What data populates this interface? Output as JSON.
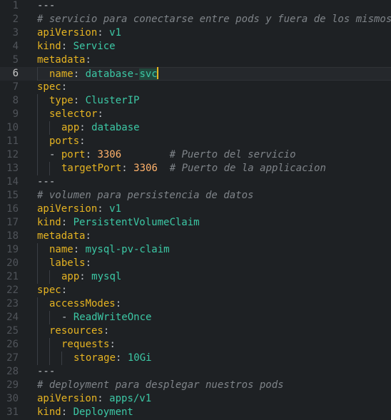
{
  "editor": {
    "language": "yaml",
    "current_line": 6,
    "colors": {
      "background": "#1e2124",
      "key": "#e6b422",
      "value": "#3cc8a5",
      "number": "#ffb26b",
      "comment": "#7f8489",
      "punctuation": "#c0c4c8",
      "line_number": "#50545a"
    },
    "lines": [
      {
        "num": "1",
        "indent": 0,
        "tokens": [
          {
            "t": "---",
            "c": "p"
          }
        ]
      },
      {
        "num": "2",
        "indent": 0,
        "tokens": [
          {
            "t": "# servicio para conectarse entre pods y fuera de los mismos",
            "c": "c"
          }
        ]
      },
      {
        "num": "3",
        "indent": 0,
        "tokens": [
          {
            "t": "apiVersion",
            "c": "k"
          },
          {
            "t": ": ",
            "c": "p"
          },
          {
            "t": "v1",
            "c": "v"
          }
        ]
      },
      {
        "num": "4",
        "indent": 0,
        "tokens": [
          {
            "t": "kind",
            "c": "k"
          },
          {
            "t": ": ",
            "c": "p"
          },
          {
            "t": "Service",
            "c": "v"
          }
        ]
      },
      {
        "num": "5",
        "indent": 0,
        "tokens": [
          {
            "t": "metadata",
            "c": "k"
          },
          {
            "t": ":",
            "c": "p"
          }
        ]
      },
      {
        "num": "6",
        "indent": 1,
        "tokens": [
          {
            "t": "name",
            "c": "k"
          },
          {
            "t": ": ",
            "c": "p"
          },
          {
            "t": "database-",
            "c": "v"
          },
          {
            "t": "svc",
            "c": "v sel"
          },
          {
            "caret": true
          }
        ]
      },
      {
        "num": "7",
        "indent": 0,
        "tokens": [
          {
            "t": "spec",
            "c": "k"
          },
          {
            "t": ":",
            "c": "p"
          }
        ]
      },
      {
        "num": "8",
        "indent": 1,
        "tokens": [
          {
            "t": "type",
            "c": "k"
          },
          {
            "t": ": ",
            "c": "p"
          },
          {
            "t": "ClusterIP",
            "c": "v"
          }
        ]
      },
      {
        "num": "9",
        "indent": 1,
        "tokens": [
          {
            "t": "selector",
            "c": "k"
          },
          {
            "t": ":",
            "c": "p"
          }
        ]
      },
      {
        "num": "10",
        "indent": 2,
        "tokens": [
          {
            "t": "app",
            "c": "k"
          },
          {
            "t": ": ",
            "c": "p"
          },
          {
            "t": "database",
            "c": "v"
          }
        ]
      },
      {
        "num": "11",
        "indent": 1,
        "tokens": [
          {
            "t": "ports",
            "c": "k"
          },
          {
            "t": ":",
            "c": "p"
          }
        ]
      },
      {
        "num": "12",
        "indent": 1,
        "tokens": [
          {
            "t": "- ",
            "c": "p"
          },
          {
            "t": "port",
            "c": "k"
          },
          {
            "t": ": ",
            "c": "p"
          },
          {
            "t": "3306",
            "c": "n"
          },
          {
            "t": "        ",
            "c": "p"
          },
          {
            "t": "# Puerto del servicio",
            "c": "c"
          }
        ]
      },
      {
        "num": "13",
        "indent": 2,
        "tokens": [
          {
            "t": "targetPort",
            "c": "k"
          },
          {
            "t": ": ",
            "c": "p"
          },
          {
            "t": "3306",
            "c": "n"
          },
          {
            "t": "  ",
            "c": "p"
          },
          {
            "t": "# Puerto de la applicacion",
            "c": "c"
          }
        ]
      },
      {
        "num": "14",
        "indent": 0,
        "tokens": [
          {
            "t": "---",
            "c": "p"
          }
        ]
      },
      {
        "num": "15",
        "indent": 0,
        "tokens": [
          {
            "t": "# volumen para persistencia de datos",
            "c": "c"
          }
        ]
      },
      {
        "num": "16",
        "indent": 0,
        "tokens": [
          {
            "t": "apiVersion",
            "c": "k"
          },
          {
            "t": ": ",
            "c": "p"
          },
          {
            "t": "v1",
            "c": "v"
          }
        ]
      },
      {
        "num": "17",
        "indent": 0,
        "tokens": [
          {
            "t": "kind",
            "c": "k"
          },
          {
            "t": ": ",
            "c": "p"
          },
          {
            "t": "PersistentVolumeClaim",
            "c": "v"
          }
        ]
      },
      {
        "num": "18",
        "indent": 0,
        "tokens": [
          {
            "t": "metadata",
            "c": "k"
          },
          {
            "t": ":",
            "c": "p"
          }
        ]
      },
      {
        "num": "19",
        "indent": 1,
        "tokens": [
          {
            "t": "name",
            "c": "k"
          },
          {
            "t": ": ",
            "c": "p"
          },
          {
            "t": "mysql-pv-claim",
            "c": "v"
          }
        ]
      },
      {
        "num": "20",
        "indent": 1,
        "tokens": [
          {
            "t": "labels",
            "c": "k"
          },
          {
            "t": ":",
            "c": "p"
          }
        ]
      },
      {
        "num": "21",
        "indent": 2,
        "tokens": [
          {
            "t": "app",
            "c": "k"
          },
          {
            "t": ": ",
            "c": "p"
          },
          {
            "t": "mysql",
            "c": "v"
          }
        ]
      },
      {
        "num": "22",
        "indent": 0,
        "tokens": [
          {
            "t": "spec",
            "c": "k"
          },
          {
            "t": ":",
            "c": "p"
          }
        ]
      },
      {
        "num": "23",
        "indent": 1,
        "tokens": [
          {
            "t": "accessModes",
            "c": "k"
          },
          {
            "t": ":",
            "c": "p"
          }
        ]
      },
      {
        "num": "24",
        "indent": 2,
        "tokens": [
          {
            "t": "- ",
            "c": "p"
          },
          {
            "t": "ReadWriteOnce",
            "c": "v"
          }
        ]
      },
      {
        "num": "25",
        "indent": 1,
        "tokens": [
          {
            "t": "resources",
            "c": "k"
          },
          {
            "t": ":",
            "c": "p"
          }
        ]
      },
      {
        "num": "26",
        "indent": 2,
        "tokens": [
          {
            "t": "requests",
            "c": "k"
          },
          {
            "t": ":",
            "c": "p"
          }
        ]
      },
      {
        "num": "27",
        "indent": 3,
        "tokens": [
          {
            "t": "storage",
            "c": "k"
          },
          {
            "t": ": ",
            "c": "p"
          },
          {
            "t": "10Gi",
            "c": "v"
          }
        ]
      },
      {
        "num": "28",
        "indent": 0,
        "tokens": [
          {
            "t": "---",
            "c": "p"
          }
        ]
      },
      {
        "num": "29",
        "indent": 0,
        "tokens": [
          {
            "t": "# deployment para desplegar nuestros pods",
            "c": "c"
          }
        ]
      },
      {
        "num": "30",
        "indent": 0,
        "tokens": [
          {
            "t": "apiVersion",
            "c": "k"
          },
          {
            "t": ": ",
            "c": "p"
          },
          {
            "t": "apps/v1",
            "c": "v"
          }
        ]
      },
      {
        "num": "31",
        "indent": 0,
        "tokens": [
          {
            "t": "kind",
            "c": "k"
          },
          {
            "t": ": ",
            "c": "p"
          },
          {
            "t": "Deployment",
            "c": "v"
          }
        ]
      }
    ]
  }
}
